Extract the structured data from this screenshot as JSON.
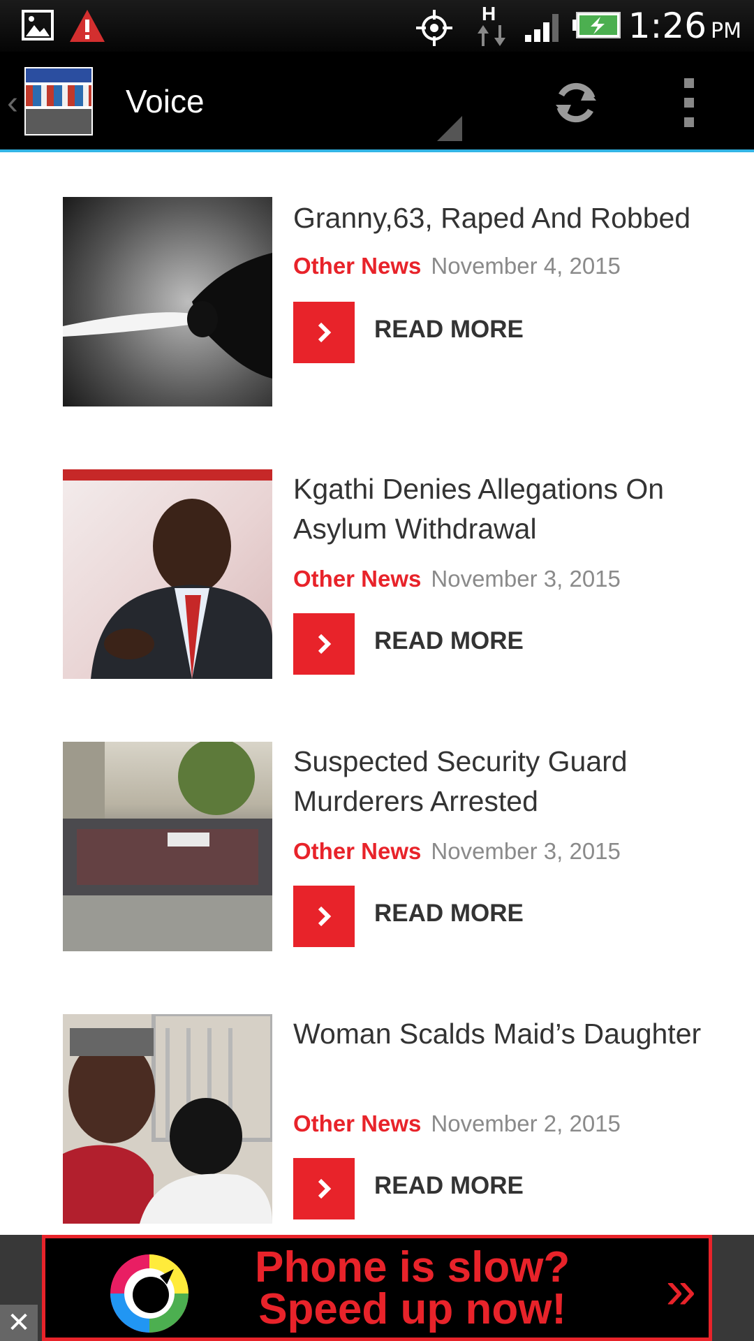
{
  "status_bar": {
    "time": "1:26",
    "ampm": "PM",
    "network": "H",
    "icons": [
      "gallery-icon",
      "warning-icon",
      "gps-icon",
      "data-icon",
      "signal-icon",
      "battery-icon"
    ]
  },
  "action_bar": {
    "title": "Voice",
    "logo": "Botswana News",
    "icons": [
      "back-chevron-icon",
      "refresh-icon",
      "overflow-menu-icon"
    ]
  },
  "articles": [
    {
      "title": "Granny,63, Raped And Robbed",
      "category": "Other News",
      "date": "November 4, 2015",
      "read_more": "READ MORE"
    },
    {
      "title": "Kgathi Denies Allegations On Asylum Withdrawal",
      "category": "Other News",
      "date": "November 3, 2015",
      "read_more": "READ MORE"
    },
    {
      "title": "Suspected Security Guard Murderers Arrested",
      "category": "Other News",
      "date": "November 3, 2015",
      "read_more": "READ MORE"
    },
    {
      "title": "Woman Scalds Maid’s Daughter",
      "category": "Other News",
      "date": "November 2, 2015",
      "read_more": "READ MORE"
    }
  ],
  "ad": {
    "line1": "Phone is slow?",
    "line2": "Speed up now!",
    "arrow": "»",
    "close": "✕"
  },
  "colors": {
    "accent": "#e8232a",
    "actionbar_line": "#33b5e5"
  }
}
